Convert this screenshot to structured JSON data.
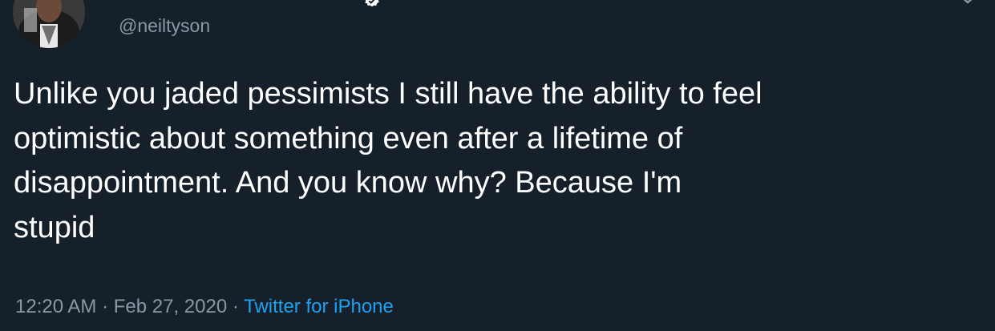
{
  "tweet": {
    "handle": "@neiltyson",
    "text_lines": [
      "Unlike you jaded pessimists I still have the ability to feel",
      "optimistic about something even after a lifetime of",
      "disappointment. And you know why? Because I'm",
      "stupid"
    ],
    "time": "12:20 AM",
    "date": "Feb 27, 2020",
    "source": "Twitter for iPhone",
    "separator": "·"
  },
  "colors": {
    "background": "#15202b",
    "text": "#ffffff",
    "secondary": "#8899a6",
    "link": "#1da1f2"
  },
  "icons": {
    "avatar": "profile-photo",
    "verified": "verified-badge-icon",
    "more": "more-options-icon"
  }
}
